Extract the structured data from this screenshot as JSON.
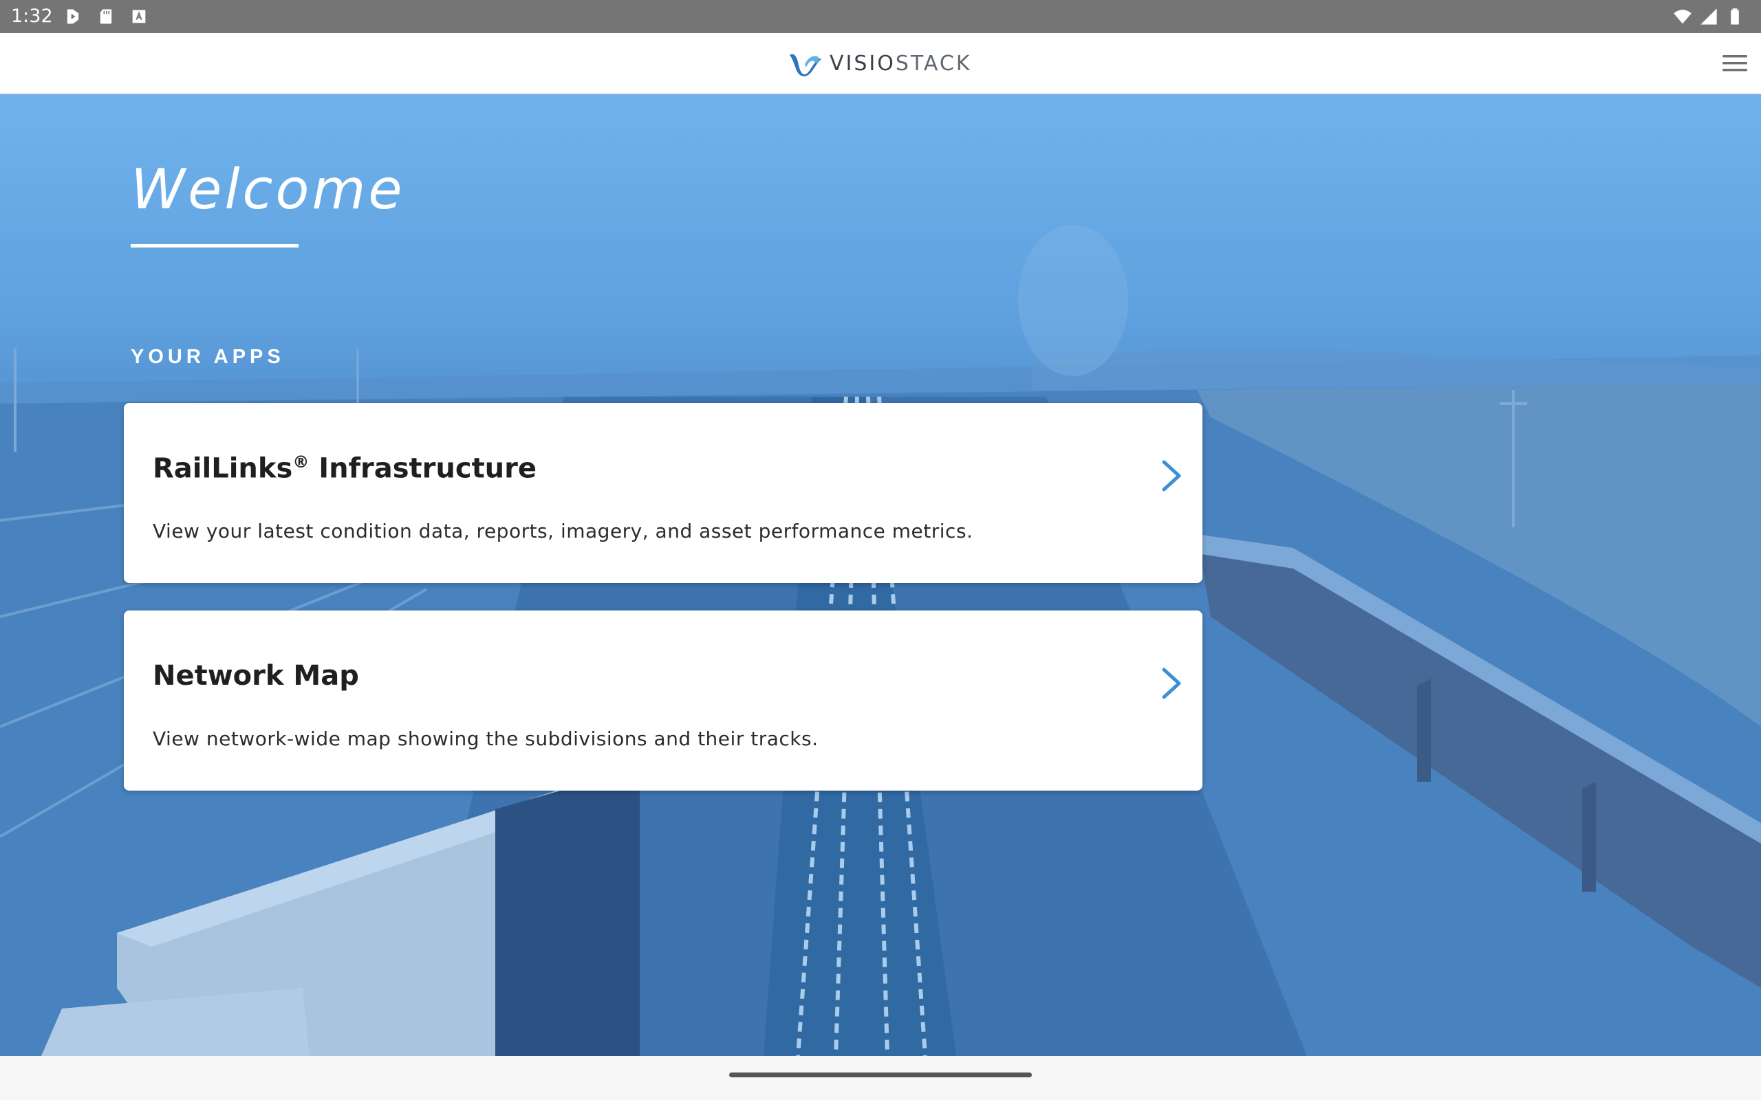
{
  "status_bar": {
    "time": "1:32",
    "left_icons": [
      "play-store-icon",
      "sd-card-icon",
      "keyboard-a-icon"
    ],
    "right_icons": [
      "wifi-icon",
      "signal-icon",
      "battery-icon"
    ]
  },
  "header": {
    "brand_part1": "VISIO",
    "brand_part2": "STACK",
    "logo_icon": "visiostack-logo-icon",
    "menu_icon": "hamburger-menu-icon"
  },
  "hero": {
    "welcome": "Welcome",
    "apps_heading": "YOUR APPS"
  },
  "apps": [
    {
      "title": "RailLinks",
      "title_mark": "®",
      "title_suffix": " Infrastructure",
      "description": "View your latest condition data, reports, imagery, and asset performance metrics.",
      "icon": "chevron-right-icon"
    },
    {
      "title": "Network Map",
      "description": "View network-wide map showing the subdivisions and their tracks.",
      "icon": "chevron-right-icon"
    }
  ],
  "colors": {
    "accent": "#3d8fd6",
    "hero_top": "#7fbdf2",
    "hero_bottom": "#3b6fa8",
    "status_bar": "#757575"
  }
}
